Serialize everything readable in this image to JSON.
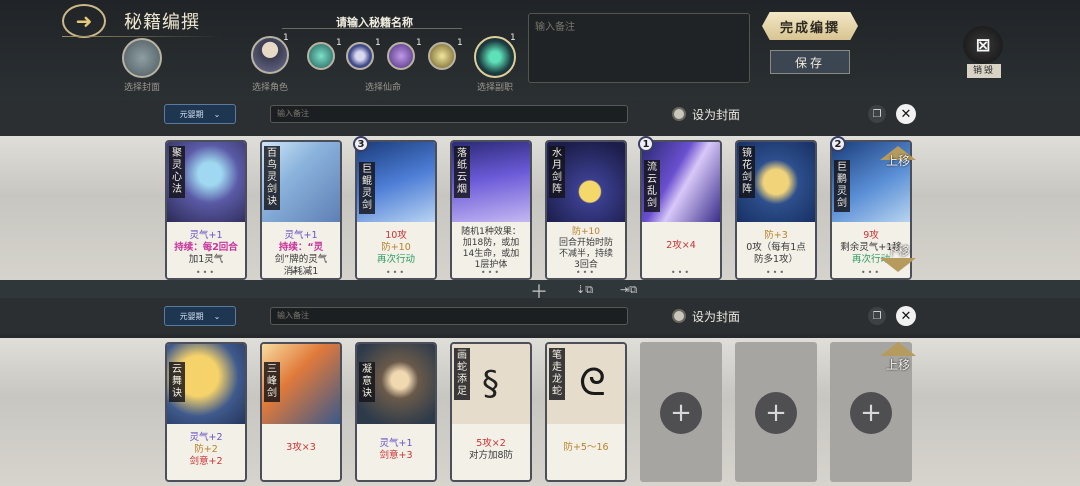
{
  "header": {
    "title": "秘籍编撰",
    "name_label": "请输入秘籍名称",
    "cover_caption": "选择封面",
    "role_caption": "选择角色",
    "fate_caption": "选择仙命",
    "deputy_caption": "选择副职",
    "role_level": "1",
    "fate_levels": [
      "1",
      "1",
      "1",
      "1"
    ],
    "deputy_level": "1",
    "note_placeholder": "输入备注",
    "finish_label": "完成编撰",
    "save_label": "保存",
    "destroy_label": "销毁"
  },
  "rows": [
    {
      "period_label": "元婴期",
      "note_placeholder": "输入备注",
      "cover_label": "设为封面",
      "cards": [
        {
          "name": "聚灵心法",
          "desc1": "灵气+1",
          "desc2": "持续：每2回合",
          "desc3": "加1灵气",
          "badge": ""
        },
        {
          "name": "百鸟灵剑诀",
          "desc1": "灵气+1",
          "desc2": "持续：“灵",
          "desc3": "剑”牌的灵气",
          "desc4": "消耗减1",
          "badge": ""
        },
        {
          "name": "巨鲲灵剑",
          "desc1": "10攻",
          "desc2": "防+10",
          "desc3": "再次行动",
          "badge": "3"
        },
        {
          "name": "落纸云烟",
          "desc1": "随机1种效果：",
          "desc2": "加18防，或加",
          "desc3": "14生命，或加",
          "desc4": "1层护体",
          "badge": ""
        },
        {
          "name": "水月剑阵",
          "desc1": "防+10",
          "desc2": "回合开始时防",
          "desc3": "不减半，持续",
          "desc4": "3回合",
          "badge": ""
        },
        {
          "name": "流云乱剑",
          "desc1": "2攻×4",
          "badge": "1"
        },
        {
          "name": "镜花剑阵",
          "desc1": "防+3",
          "desc2": "0攻（每有1点",
          "desc3": "防多1攻）",
          "badge": ""
        },
        {
          "name": "巨鹏灵剑",
          "desc1": "9攻",
          "desc2": "剩余灵气+1移",
          "desc3": "再次行动",
          "badge": "2"
        }
      ],
      "move_up": "上移",
      "move_down": "下移"
    },
    {
      "period_label": "元婴期",
      "note_placeholder": "输入备注",
      "cover_label": "设为封面",
      "cards": [
        {
          "name": "云舞诀",
          "desc1": "灵气+2",
          "desc2": "防+2",
          "desc3": "剑意+2",
          "badge": ""
        },
        {
          "name": "三峰剑",
          "desc1": "3攻×3",
          "badge": ""
        },
        {
          "name": "凝意诀",
          "desc1": "灵气+1",
          "desc2": "剑意+3",
          "badge": ""
        },
        {
          "name": "画蛇添足",
          "desc1": "5攻×2",
          "desc2": "对方加8防",
          "badge": ""
        },
        {
          "name": "笔走龙蛇",
          "desc1": "防+5～16",
          "badge": ""
        }
      ],
      "move_up": "上移"
    }
  ],
  "colors": {
    "accent_gold": "#d8c491",
    "period_blue": "#1f3650",
    "pink_keyword": "#c8359c",
    "red_attack": "#cc3333"
  }
}
